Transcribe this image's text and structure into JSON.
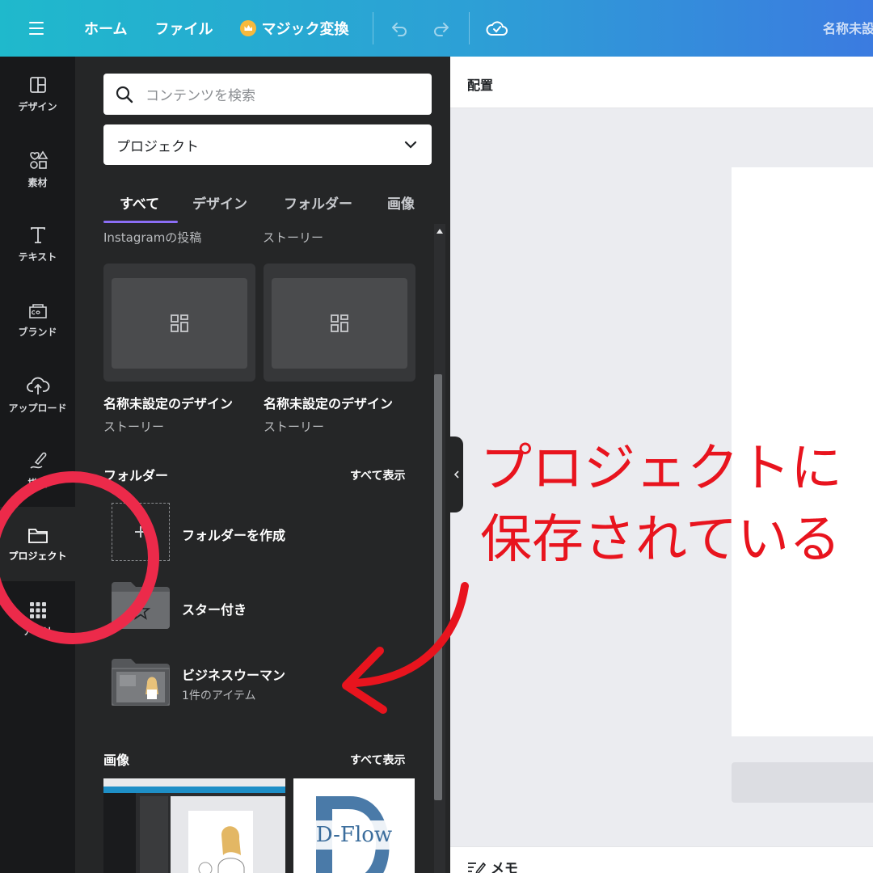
{
  "topbar": {
    "home": "ホーム",
    "file": "ファイル",
    "magic": "マジック変換",
    "title": "名称未設"
  },
  "rail": {
    "items": [
      {
        "label": "デザイン"
      },
      {
        "label": "素材"
      },
      {
        "label": "テキスト"
      },
      {
        "label": "ブランド"
      },
      {
        "label": "アップロード"
      },
      {
        "label": "描画"
      },
      {
        "label": "プロジェクト"
      },
      {
        "label": "アプリ"
      }
    ]
  },
  "panel": {
    "search_placeholder": "コンテンツを検索",
    "select_value": "プロジェクト",
    "tabs": [
      "すべて",
      "デザイン",
      "フォルダー",
      "画像"
    ],
    "designs": {
      "type_labels": [
        "Instagramの投稿",
        "ストーリー"
      ],
      "cards": [
        {
          "title": "名称未設定のデザイン",
          "subtitle": "ストーリー"
        },
        {
          "title": "名称未設定のデザイン",
          "subtitle": "ストーリー"
        }
      ]
    },
    "folders": {
      "title": "フォルダー",
      "see_all": "すべて表示",
      "create": "フォルダーを作成",
      "items": [
        {
          "name": "スター付き"
        },
        {
          "name": "ビジネスウーマン",
          "count": "1件のアイテム"
        }
      ]
    },
    "images": {
      "title": "画像",
      "see_all": "すべて表示",
      "thumb2_text": "D-Flow"
    }
  },
  "editor": {
    "position_label": "配置",
    "notes_label": "メモ"
  },
  "annotation": {
    "line1": "プロジェクトに",
    "line2": "保存されている",
    "color": "#e8141e"
  }
}
